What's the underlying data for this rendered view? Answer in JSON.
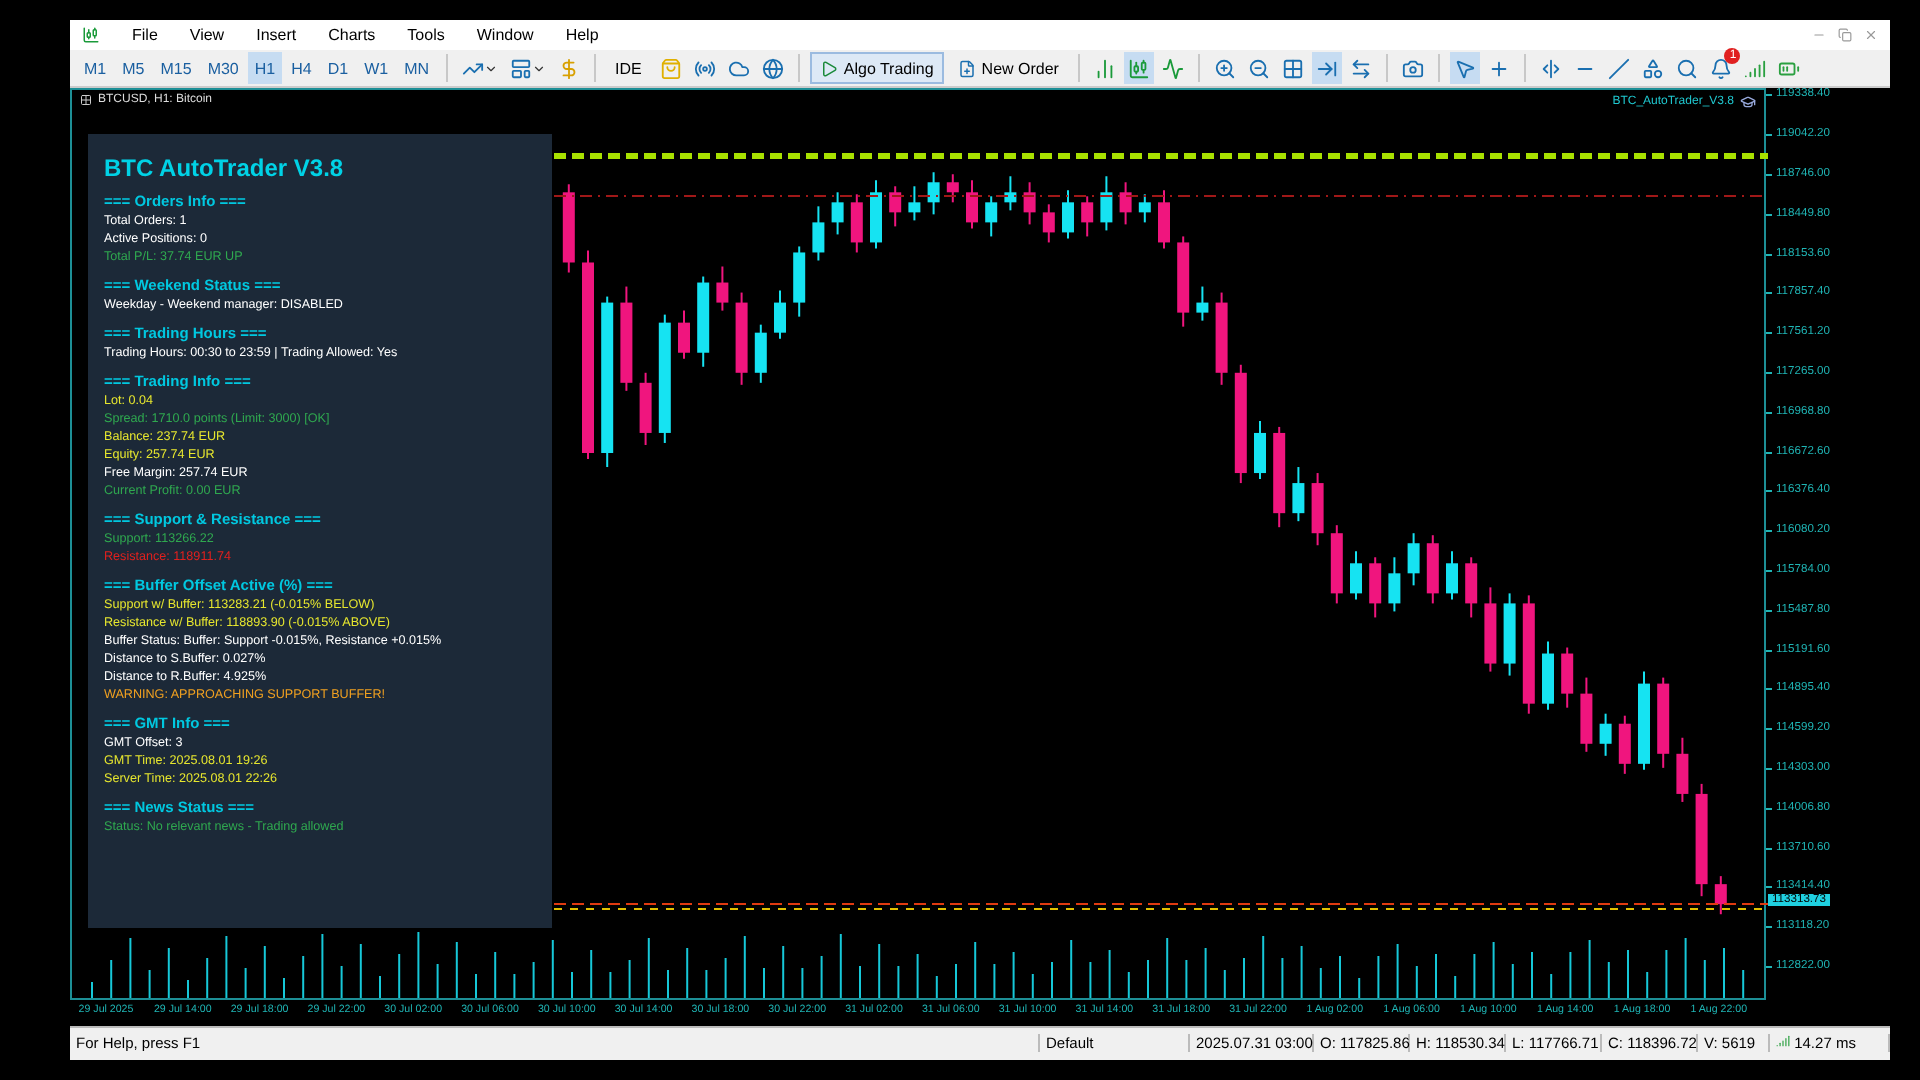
{
  "menu": [
    "File",
    "View",
    "Insert",
    "Charts",
    "Tools",
    "Window",
    "Help"
  ],
  "toolbar": [
    {
      "kind": "timeframe",
      "label": "M1",
      "selected": false
    },
    {
      "kind": "timeframe",
      "label": "M5",
      "selected": false
    },
    {
      "kind": "timeframe",
      "label": "M15",
      "selected": false
    },
    {
      "kind": "timeframe",
      "label": "M30",
      "selected": false
    },
    {
      "kind": "timeframe",
      "label": "H1",
      "selected": true
    },
    {
      "kind": "timeframe",
      "label": "H4",
      "selected": false
    },
    {
      "kind": "timeframe",
      "label": "D1",
      "selected": false
    },
    {
      "kind": "timeframe",
      "label": "W1",
      "selected": false
    },
    {
      "kind": "timeframe",
      "label": "MN",
      "selected": false
    },
    {
      "kind": "separator"
    },
    {
      "kind": "icon",
      "selected": false
    },
    {
      "kind": "icon",
      "selected": false
    },
    {
      "kind": "icon",
      "selected": false
    },
    {
      "kind": "separator"
    },
    {
      "kind": "text",
      "label": "IDE",
      "selected": false
    },
    {
      "kind": "icon",
      "selected": false
    },
    {
      "kind": "icon",
      "selected": false
    },
    {
      "kind": "icon",
      "selected": false
    },
    {
      "kind": "icon",
      "selected": false
    },
    {
      "kind": "separator"
    },
    {
      "kind": "text",
      "label": "Algo Trading",
      "selected": true
    },
    {
      "kind": "text",
      "label": "New Order",
      "selected": false
    },
    {
      "kind": "separator"
    },
    {
      "kind": "icon",
      "selected": false
    },
    {
      "kind": "icon",
      "selected": true
    },
    {
      "kind": "icon",
      "selected": false
    },
    {
      "kind": "separator"
    },
    {
      "kind": "icon",
      "selected": false
    },
    {
      "kind": "icon",
      "selected": false
    },
    {
      "kind": "icon",
      "selected": false
    },
    {
      "kind": "icon",
      "selected": true
    },
    {
      "kind": "icon",
      "selected": false
    },
    {
      "kind": "separator"
    },
    {
      "kind": "icon",
      "selected": false
    },
    {
      "kind": "separator"
    },
    {
      "kind": "icon",
      "selected": true
    },
    {
      "kind": "icon",
      "selected": false
    },
    {
      "kind": "separator"
    },
    {
      "kind": "icon",
      "selected": false
    },
    {
      "kind": "icon",
      "selected": false
    },
    {
      "kind": "icon",
      "selected": false
    },
    {
      "kind": "icon",
      "selected": false
    },
    {
      "kind": "icon",
      "selected": false
    },
    {
      "kind": "icon",
      "badge": "1",
      "selected": false
    },
    {
      "kind": "icon",
      "selected": false
    },
    {
      "kind": "icon",
      "selected": false
    }
  ],
  "chart": {
    "symbol": "BTCUSD, H1: Bitcoin",
    "expert": "BTC_AutoTrader_V3.8",
    "current_price": "113313.73",
    "chart_data": {
      "type": "candlestick",
      "categories": [
        "29 Jul 2025",
        null,
        null,
        null,
        "29 Jul 14:00",
        null,
        null,
        null,
        "29 Jul 18:00",
        null,
        null,
        null,
        "29 Jul 22:00",
        null,
        null,
        null,
        "30 Jul 02:00",
        null,
        null,
        null,
        "30 Jul 06:00",
        null,
        null,
        null,
        "30 Jul 10:00",
        null,
        null,
        null,
        "30 Jul 14:00",
        null,
        null,
        null,
        "30 Jul 18:00",
        null,
        null,
        null,
        "30 Jul 22:00",
        null,
        null,
        null,
        "31 Jul 02:00",
        null,
        null,
        null,
        "31 Jul 06:00",
        null,
        null,
        null,
        "31 Jul 10:00",
        null,
        null,
        null,
        "31 Jul 14:00",
        null,
        null,
        null,
        "31 Jul 18:00",
        null,
        null,
        null,
        "31 Jul 22:00",
        null,
        null,
        null,
        "1 Aug 02:00",
        null,
        null,
        null,
        "1 Aug 06:00",
        null,
        null,
        null,
        "1 Aug 10:00",
        null,
        null,
        null,
        "1 Aug 14:00",
        null,
        null,
        null,
        "1 Aug 18:00",
        null,
        null,
        null,
        "1 Aug 22:00"
      ],
      "ylim": [
        112576.5,
        119398.2
      ],
      "yticks": [
        {
          "value": 119338.4,
          "label": "119338.40"
        },
        {
          "value": 119042.2,
          "label": "119042.20"
        },
        {
          "value": 118746,
          "label": "118746.00"
        },
        {
          "value": 118449.8,
          "label": "118449.80"
        },
        {
          "value": 118153.6,
          "label": "118153.60"
        },
        {
          "value": 117857.4,
          "label": "117857.40"
        },
        {
          "value": 117561.2,
          "label": "117561.20"
        },
        {
          "value": 117265,
          "label": "117265.00"
        },
        {
          "value": 116968.8,
          "label": "116968.80"
        },
        {
          "value": 116672.6,
          "label": "116672.60"
        },
        {
          "value": 116376.4,
          "label": "116376.40"
        },
        {
          "value": 116080.2,
          "label": "116080.20"
        },
        {
          "value": 115784,
          "label": "115784.00"
        },
        {
          "value": 115487.8,
          "label": "115487.80"
        },
        {
          "value": 115191.6,
          "label": "115191.60"
        },
        {
          "value": 114895.4,
          "label": "114895.40"
        },
        {
          "value": 114599.2,
          "label": "114599.20"
        },
        {
          "value": 114303,
          "label": "114303.00"
        },
        {
          "value": 114006.8,
          "label": "114006.80"
        },
        {
          "value": 113710.6,
          "label": "113710.60"
        },
        {
          "value": 113414.4,
          "label": "113414.40"
        },
        {
          "value": 113118.2,
          "label": "113118.20"
        },
        {
          "value": 112822,
          "label": "112822.00"
        }
      ],
      "ohlc": [
        null,
        null,
        null,
        null,
        null,
        null,
        null,
        null,
        null,
        null,
        null,
        null,
        null,
        null,
        null,
        null,
        null,
        null,
        null,
        null,
        null,
        null,
        null,
        null,
        [
          118633,
          118693,
          118033,
          118108
        ],
        [
          118108,
          118198,
          116638,
          116683
        ],
        [
          116683,
          117853,
          116578,
          117808
        ],
        [
          117808,
          117928,
          117148,
          117208
        ],
        [
          117208,
          117283,
          116743,
          116833
        ],
        [
          116833,
          117718,
          116758,
          117658
        ],
        [
          117658,
          117748,
          117388,
          117433
        ],
        [
          117433,
          118003,
          117328,
          117958
        ],
        [
          117958,
          118078,
          117748,
          117808
        ],
        [
          117808,
          117883,
          117193,
          117283
        ],
        [
          117283,
          117643,
          117208,
          117583
        ],
        [
          117583,
          117898,
          117538,
          117808
        ],
        [
          117808,
          118228,
          117703,
          118183
        ],
        [
          118183,
          118528,
          118123,
          118408
        ],
        [
          118408,
          118633,
          118318,
          118558
        ],
        [
          118558,
          118618,
          118183,
          118258
        ],
        [
          118258,
          118723,
          118213,
          118633
        ],
        [
          118633,
          118678,
          118378,
          118483
        ],
        [
          118483,
          118678,
          118423,
          118558
        ],
        [
          118558,
          118783,
          118468,
          118708
        ],
        [
          118708,
          118768,
          118558,
          118633
        ],
        [
          118633,
          118723,
          118363,
          118408
        ],
        [
          118408,
          118603,
          118303,
          118558
        ],
        [
          118558,
          118753,
          118498,
          118633
        ],
        [
          118633,
          118708,
          118393,
          118483
        ],
        [
          118483,
          118543,
          118258,
          118333
        ],
        [
          118333,
          118648,
          118288,
          118558
        ],
        [
          118558,
          118603,
          118303,
          118408
        ],
        [
          118408,
          118753,
          118348,
          118633
        ],
        [
          118633,
          118708,
          118393,
          118483
        ],
        [
          118483,
          118618,
          118408,
          118558
        ],
        [
          118558,
          118648,
          118213,
          118258
        ],
        [
          118258,
          118303,
          117628,
          117733
        ],
        [
          117733,
          117928,
          117673,
          117808
        ],
        [
          117808,
          117883,
          117193,
          117283
        ],
        [
          117283,
          117343,
          116458,
          116533
        ],
        [
          116533,
          116923,
          116488,
          116833
        ],
        [
          116833,
          116878,
          116128,
          116233
        ],
        [
          116233,
          116578,
          116173,
          116458
        ],
        [
          116458,
          116533,
          115993,
          116083
        ],
        [
          116083,
          116143,
          115558,
          115633
        ],
        [
          115633,
          115948,
          115588,
          115858
        ],
        [
          115858,
          115903,
          115453,
          115558
        ],
        [
          115558,
          115903,
          115498,
          115783
        ],
        [
          115783,
          116083,
          115693,
          116008
        ],
        [
          116008,
          116068,
          115558,
          115633
        ],
        [
          115633,
          115948,
          115588,
          115858
        ],
        [
          115858,
          115903,
          115453,
          115558
        ],
        [
          115558,
          115678,
          115048,
          115108
        ],
        [
          115108,
          115633,
          115018,
          115558
        ],
        [
          115558,
          115618,
          114733,
          114808
        ],
        [
          114808,
          115273,
          114763,
          115183
        ],
        [
          115183,
          115228,
          114778,
          114883
        ],
        [
          114883,
          115003,
          114448,
          114508
        ],
        [
          114508,
          114733,
          114418,
          114658
        ],
        [
          114658,
          114718,
          114283,
          114358
        ],
        [
          114358,
          115048,
          114313,
          114958
        ],
        [
          114958,
          115003,
          114328,
          114433
        ],
        [
          114433,
          114553,
          114073,
          114133
        ],
        [
          114133,
          114208,
          113368,
          113458
        ],
        [
          113458,
          113518,
          113233,
          113308
        ]
      ]
    }
  },
  "panel": {
    "title": "BTC AutoTrader V3.8",
    "sections": [
      {
        "heading": "=== Orders Info ===",
        "lines": [
          {
            "text": "Total Orders: 1",
            "color": "#ffffff"
          },
          {
            "text": "Active Positions: 0",
            "color": "#ffffff"
          },
          {
            "text": "Total P/L: 37.74 EUR UP",
            "color": "#2fa84f"
          }
        ]
      },
      {
        "heading": "=== Weekend Status ===",
        "lines": [
          {
            "text": "Weekday - Weekend manager: DISABLED",
            "color": "#ffffff"
          }
        ]
      },
      {
        "heading": "=== Trading Hours ===",
        "lines": [
          {
            "text": "Trading Hours: 00:30 to 23:59 | Trading Allowed: Yes",
            "color": "#ffffff"
          }
        ]
      },
      {
        "heading": "=== Trading Info ===",
        "lines": [
          {
            "text": "Lot: 0.04",
            "color": "#e6e62e"
          },
          {
            "text": "Spread: 1710.0 points (Limit: 3000) [OK]",
            "color": "#2fa84f"
          },
          {
            "text": "Balance: 237.74 EUR",
            "color": "#e6e62e"
          },
          {
            "text": "Equity: 257.74 EUR",
            "color": "#e6e62e"
          },
          {
            "text": "Free Margin: 257.74 EUR",
            "color": "#ffffff"
          },
          {
            "text": "Current Profit: 0.00 EUR",
            "color": "#2fa84f"
          }
        ]
      },
      {
        "heading": "=== Support & Resistance ===",
        "lines": [
          {
            "text": "Support: 113266.22",
            "color": "#2fa84f"
          },
          {
            "text": "Resistance: 118911.74",
            "color": "#e0201e"
          }
        ]
      },
      {
        "heading": "=== Buffer Offset Active (%) ===",
        "lines": [
          {
            "text": "Support w/ Buffer: 113283.21 (-0.015% BELOW)",
            "color": "#e6e62e"
          },
          {
            "text": "Resistance w/ Buffer: 118893.90 (-0.015% ABOVE)",
            "color": "#e6e62e"
          },
          {
            "text": "Buffer Status: Buffer: Support -0.015%, Resistance +0.015%",
            "color": "#ffffff"
          },
          {
            "text": "Distance to S.Buffer: 0.027%",
            "color": "#ffffff"
          },
          {
            "text": "Distance to R.Buffer: 4.925%",
            "color": "#ffffff"
          },
          {
            "text": "WARNING: APPROACHING SUPPORT BUFFER!",
            "color": "#f0a020"
          }
        ]
      },
      {
        "heading": "=== GMT Info ===",
        "lines": [
          {
            "text": "GMT Offset: 3",
            "color": "#ffffff"
          },
          {
            "text": "GMT Time: 2025.08.01 19:26",
            "color": "#e6e62e"
          },
          {
            "text": "Server Time: 2025.08.01 22:26",
            "color": "#e6e62e"
          }
        ]
      },
      {
        "heading": "=== News Status ===",
        "lines": [
          {
            "text": "Status: No relevant news - Trading allowed",
            "color": "#2fa84f"
          }
        ]
      }
    ]
  },
  "status_bar": [
    "For Help, press F1",
    "Default",
    "2025.07.31 03:00",
    "O: 117825.86",
    "H: 118530.34",
    "L: 117766.71",
    "C: 118396.72",
    "V: 5619",
    "14.27 ms"
  ]
}
